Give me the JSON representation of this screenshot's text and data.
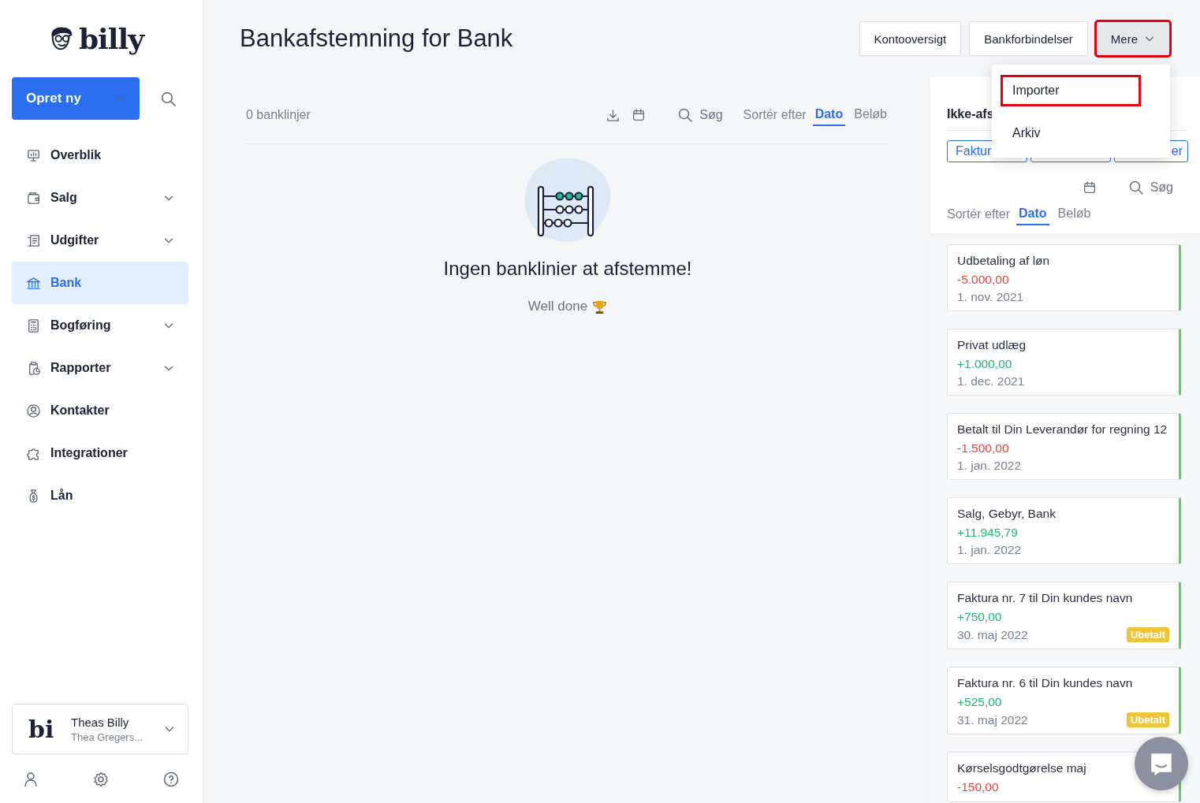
{
  "sidebar": {
    "logo": {
      "text": "billy"
    },
    "create_button": {
      "label": "Opret ny"
    },
    "nav": [
      {
        "label": "Overblik",
        "expandable": false,
        "selected": false
      },
      {
        "label": "Salg",
        "expandable": true,
        "selected": false
      },
      {
        "label": "Udgifter",
        "expandable": true,
        "selected": false
      },
      {
        "label": "Bank",
        "expandable": false,
        "selected": true
      },
      {
        "label": "Bogføring",
        "expandable": true,
        "selected": false
      },
      {
        "label": "Rapporter",
        "expandable": true,
        "selected": false
      },
      {
        "label": "Kontakter",
        "expandable": false,
        "selected": false
      },
      {
        "label": "Integrationer",
        "expandable": false,
        "selected": false
      },
      {
        "label": "Lån",
        "expandable": false,
        "selected": false
      }
    ],
    "organization": {
      "logo_text": "bi",
      "name": "Theas Billy",
      "user": "Thea Gregers..."
    }
  },
  "header": {
    "title": "Bankafstemning for Bank",
    "buttons": [
      {
        "label": "Kontooversigt",
        "highlighted": false
      },
      {
        "label": "Bankforbindelser",
        "highlighted": false
      },
      {
        "label": "Mere",
        "highlighted": true
      }
    ]
  },
  "dropdown": {
    "items": [
      {
        "label": "Importer",
        "highlighted": true
      },
      {
        "label": "Arkiv",
        "highlighted": false
      }
    ]
  },
  "bank_lines": {
    "count": "0 banklinjer",
    "search": "Søg",
    "sort_label": "Sortér efter",
    "sort_options": [
      {
        "label": "Dato",
        "selected": true
      },
      {
        "label": "Beløb",
        "selected": false
      }
    ],
    "empty": {
      "title": "Ingen banklinier at afstemme!",
      "message": "Well done"
    }
  },
  "side_panel": {
    "heading": "Ikke-afs",
    "chips": [
      "Faktur",
      "er"
    ],
    "search": "Søg",
    "sort_label": "Sortér efter",
    "sort_options": [
      {
        "label": "Dato",
        "selected": true
      },
      {
        "label": "Beløb",
        "selected": false
      }
    ],
    "entries": [
      {
        "title": "Udbetaling af løn",
        "amount": "-5.000,00",
        "kind": "negative",
        "date": "1. nov. 2021"
      },
      {
        "title": "Privat udlæg",
        "amount": "+1.000,00",
        "kind": "positive",
        "date": "1. dec. 2021"
      },
      {
        "title": "Betalt til Din Leverandør for regning 12",
        "amount": "-1.500,00",
        "kind": "negative",
        "date": "1. jan. 2022"
      },
      {
        "title": "Salg, Gebyr, Bank",
        "amount": "+11.945,79",
        "kind": "positive",
        "date": "1. jan. 2022"
      },
      {
        "title": "Faktura nr. 7 til Din kundes navn",
        "amount": "+750,00",
        "kind": "positive",
        "date": "30. maj 2022",
        "badge": "Ubetalt"
      },
      {
        "title": "Faktura nr. 6 til Din kundes navn",
        "amount": "+525,00",
        "kind": "positive",
        "date": "31. maj 2022",
        "badge": "Ubetalt"
      },
      {
        "title": "Kørselsgodtgørelse maj",
        "amount": "-150,00",
        "kind": "negative"
      }
    ]
  }
}
